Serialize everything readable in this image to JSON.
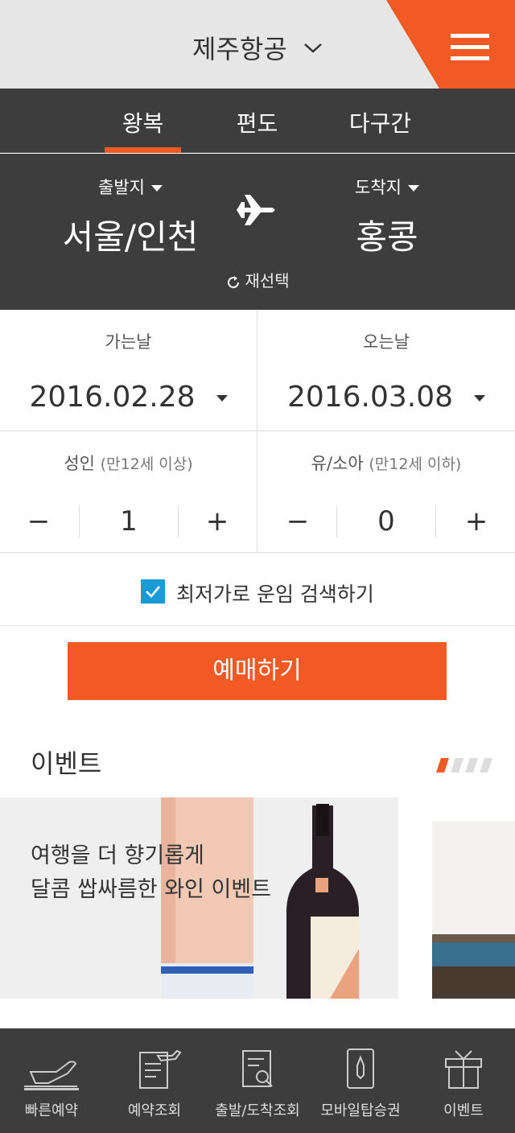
{
  "header": {
    "airline": "제주항공",
    "menu_icon": "hamburger-icon"
  },
  "trip_tabs": [
    {
      "label": "왕복",
      "active": true
    },
    {
      "label": "편도",
      "active": false
    },
    {
      "label": "다구간",
      "active": false
    }
  ],
  "route": {
    "departure_label": "출발지",
    "departure_city": "서울/인천",
    "arrival_label": "도착지",
    "arrival_city": "홍콩",
    "reselect": "재선택"
  },
  "dates": {
    "depart_label": "가는날",
    "depart_value": "2016.02.28",
    "return_label": "오는날",
    "return_value": "2016.03.08"
  },
  "passengers": {
    "adult_label": "성인",
    "adult_sub": "(만12세 이상)",
    "adult_count": "1",
    "child_label": "유/소아",
    "child_sub": "(만12세 이하)",
    "child_count": "0",
    "minus": "−",
    "plus": "+"
  },
  "lowest_fare": {
    "label": "최저가로 운임 검색하기",
    "checked": true
  },
  "book_button": "예매하기",
  "events": {
    "title": "이벤트",
    "pager_count": 4,
    "pager_active": 0,
    "card_line1": "여행을 더 향기롭게",
    "card_line2": "달콤 쌉싸름한 와인 이벤트"
  },
  "bottom_nav": [
    {
      "label": "빠른예약",
      "icon": "plane-icon",
      "active": true
    },
    {
      "label": "예약조회",
      "icon": "ticket-doc-icon"
    },
    {
      "label": "출발/도착조회",
      "icon": "search-doc-icon"
    },
    {
      "label": "모바일탑승권",
      "icon": "mobile-pass-icon"
    },
    {
      "label": "이벤트",
      "icon": "gift-icon"
    }
  ],
  "colors": {
    "accent": "#f15a24",
    "dark": "#3d3d3d",
    "check": "#1a9bd8"
  }
}
